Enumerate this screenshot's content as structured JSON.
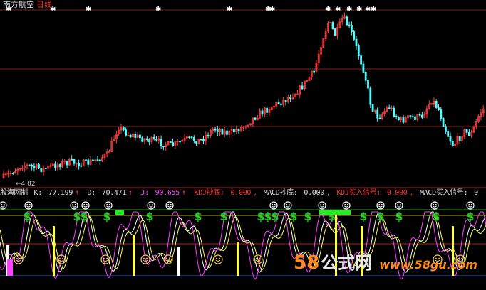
{
  "header": {
    "stock_name": "南方航空",
    "period": "日线"
  },
  "price_low_label": "4.82",
  "indicator": {
    "name": "股海网制",
    "k_label": "K:",
    "k_value": "77.199",
    "d_label": "D:",
    "d_value": "70.471",
    "j_label": "J:",
    "j_value": "90.655",
    "kdj_bottom_label": "KDJ抄底:",
    "kdj_bottom_value": "0.000",
    "macd_bottom_label": "MACD抄底:",
    "macd_bottom_value": "0.000",
    "kdj_buy_label": "KDJ买入信号:",
    "kdj_buy_value": "0.000",
    "macd_buy_label": "MACD买入信号:",
    "macd_buy_value": "0"
  },
  "watermark": {
    "part1": "58",
    "part2": "公式网",
    "url": "www.58gu.com"
  },
  "colors": {
    "up": "#ff3c3c",
    "down": "#54ffff",
    "k_line": "#ffffff",
    "d_line": "#ffff54",
    "j_line": "#ff40ff",
    "dollar": "#22cc22",
    "smiley": "#ffd24d",
    "red_level": "#cc2020"
  }
}
